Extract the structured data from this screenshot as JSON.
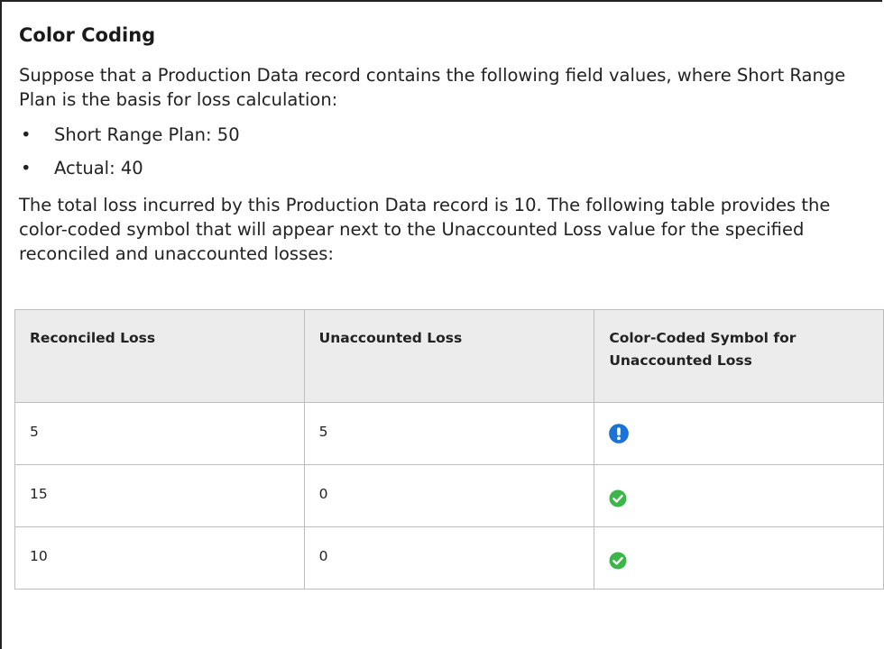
{
  "section": {
    "title": "Color Coding",
    "intro": "Suppose that a Production Data record contains the following field values, where Short Range Plan is the basis for loss calculation:",
    "fields": [
      {
        "bullet": "•",
        "text": "Short Range Plan: 50"
      },
      {
        "bullet": "•",
        "text": "Actual: 40"
      }
    ],
    "explanation": "The total loss incurred by this Production Data record is 10. The following table provides the color-coded symbol that will appear next to the Unaccounted Loss value for the specified reconciled and unaccounted losses:"
  },
  "table": {
    "headers": [
      "Reconciled Loss",
      "Unaccounted Loss",
      "Color-Coded Symbol for Unaccounted Loss"
    ],
    "rows": [
      {
        "reconciled": "5",
        "unaccounted": "5",
        "symbol": "exclamation-circle-icon"
      },
      {
        "reconciled": "15",
        "unaccounted": "0",
        "symbol": "check-circle-icon"
      },
      {
        "reconciled": "10",
        "unaccounted": "0",
        "symbol": "check-circle-icon"
      }
    ]
  },
  "colors": {
    "warning_blue": "#1a73d9",
    "success_green": "#3cb54a"
  }
}
